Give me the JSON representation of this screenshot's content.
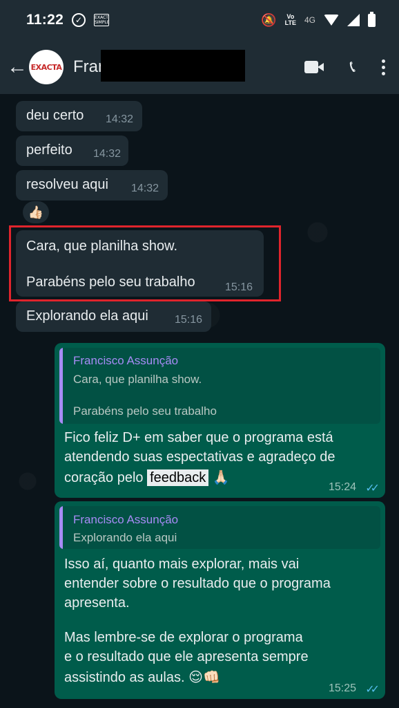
{
  "status_bar": {
    "time": "11:22",
    "check_icon": "check-circle-icon",
    "sim_icon": "sim-card-icon",
    "mute_icon": "notifications-off-icon",
    "volte_top": "Vo",
    "volte_bottom": "LTE",
    "network": "4G"
  },
  "sim_label_top": "EXACT",
  "sim_label_bottom": "SIMPLE",
  "header": {
    "contact_name": "Fran",
    "avatar_logo": "EXACTA"
  },
  "messages_in": [
    {
      "text": "deu certo",
      "time": "14:32"
    },
    {
      "text": "perfeito",
      "time": "14:32"
    },
    {
      "text": "resolveu aqui",
      "time": "14:32"
    }
  ],
  "reaction_emoji": "👍🏻",
  "highlighted_message": {
    "line1": "Cara, que planilha show.",
    "line2": "Parabéns pelo seu trabalho",
    "time": "15:16"
  },
  "message_exploring": {
    "text": "Explorando ela aqui",
    "time": "15:16"
  },
  "reply1": {
    "quote_author": "Francisco Assunção",
    "quote_line1": "Cara, que planilha show.",
    "quote_line2": "Parabéns pelo seu trabalho",
    "line1": "Fico feliz D+ em saber que o programa está",
    "line2": "atendendo suas espectativas e agradeço de",
    "line3_pre": "coração pelo ",
    "line3_highlight": "feedback",
    "line3_emoji": "🙏🏻",
    "time": "15:24",
    "ticks": "✓✓"
  },
  "reply2": {
    "quote_author": "Francisco Assunção",
    "quote_line1": "Explorando ela aqui",
    "line1": "Isso aí, quanto mais explorar, mais vai",
    "line2": "entender sobre o resultado que o programa",
    "line3": "apresenta.",
    "line4": "Mas lembre-se de explorar o programa",
    "line5": "e o resultado que ele apresenta sempre",
    "line6_text": "assistindo as aulas.",
    "line6_emoji": "😌👊🏻",
    "time": "15:25",
    "ticks": "✓✓"
  },
  "colors": {
    "background": "#0b141a",
    "incoming_bubble": "#1f2c34",
    "outgoing_bubble": "#005c4b",
    "quote_accent": "#a78bf5",
    "highlight_border": "#e0242c",
    "read_ticks": "#53bdeb"
  }
}
